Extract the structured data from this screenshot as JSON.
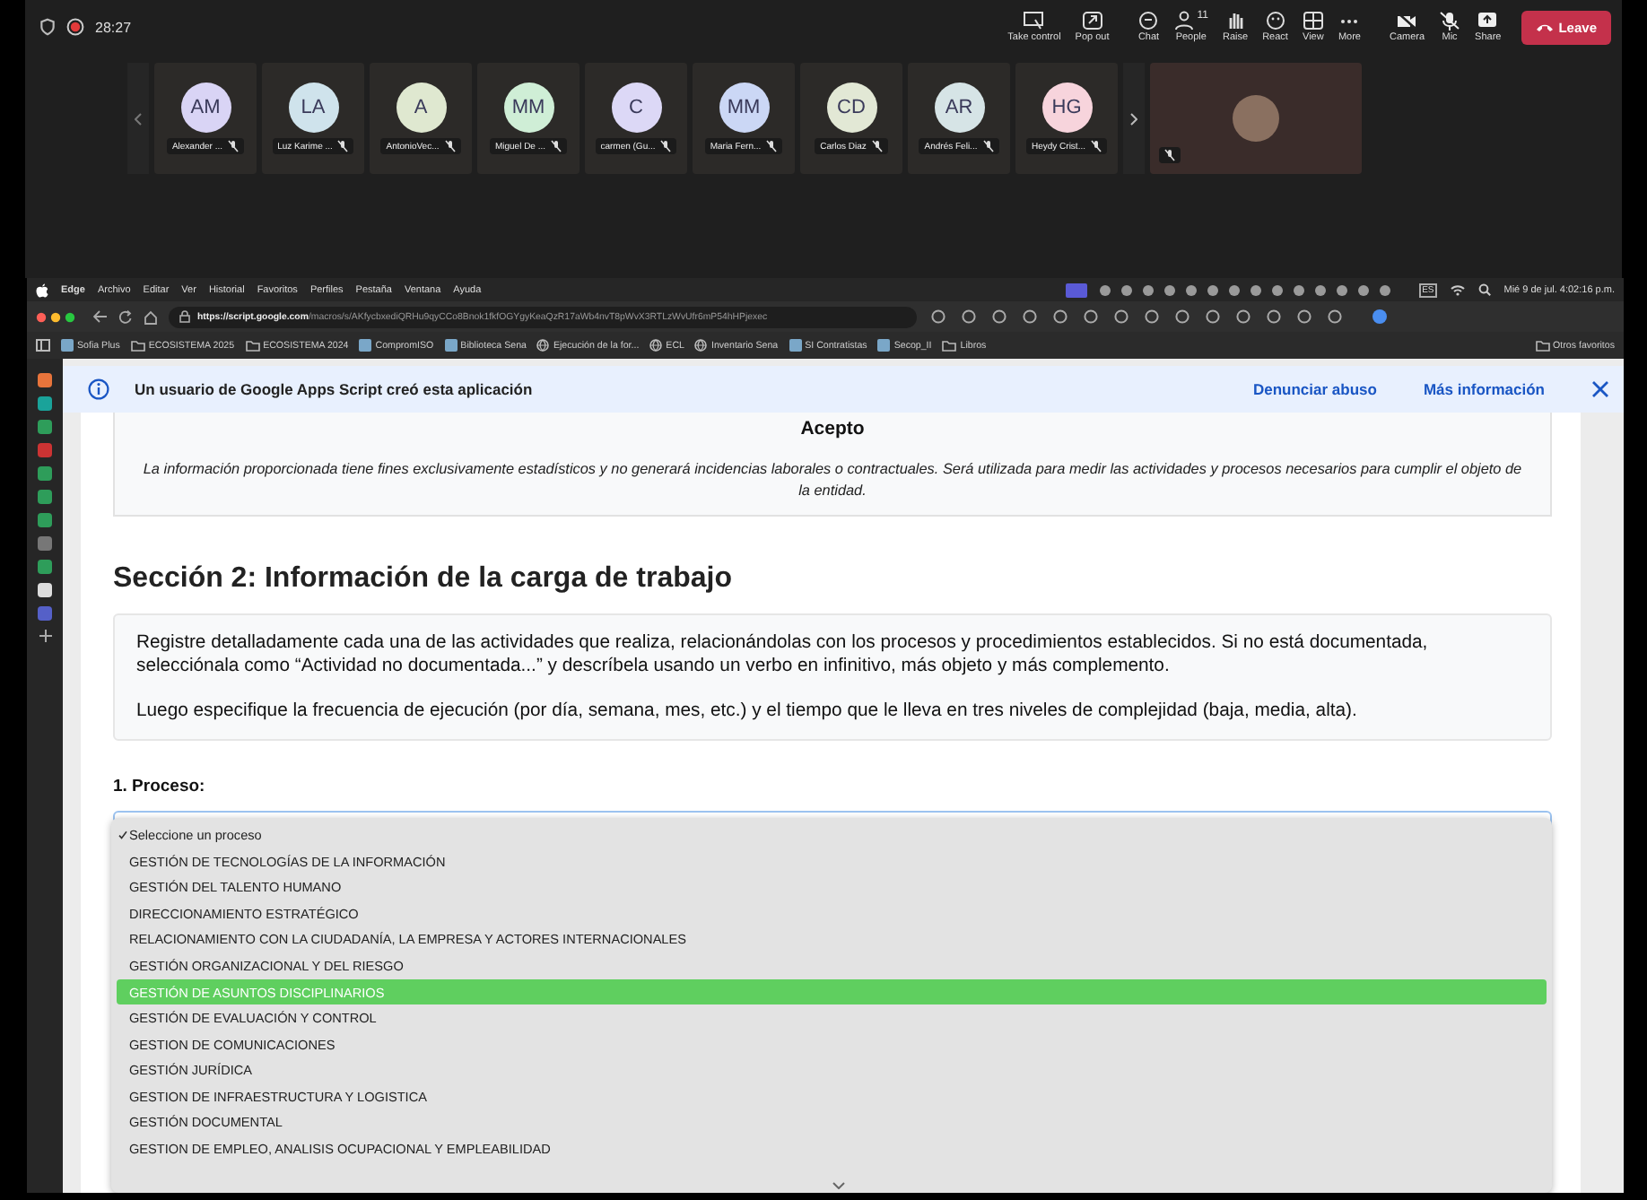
{
  "meeting": {
    "timer": "28:27",
    "recording": true,
    "toolbar": [
      {
        "label": "Take control"
      },
      {
        "label": "Pop out"
      },
      {
        "label": "Chat"
      },
      {
        "label": "People",
        "count": "11"
      },
      {
        "label": "Raise"
      },
      {
        "label": "React"
      },
      {
        "label": "View"
      },
      {
        "label": "More"
      },
      {
        "label": "Camera"
      },
      {
        "label": "Mic"
      },
      {
        "label": "Share"
      }
    ],
    "leave": "Leave",
    "participants": [
      {
        "initials": "AM",
        "name": "Alexander ...",
        "color": "#d9d4f5"
      },
      {
        "initials": "LA",
        "name": "Luz Karime ...",
        "color": "#cfe3ec"
      },
      {
        "initials": "A",
        "name": "AntonioVec...",
        "color": "#dfe8d0"
      },
      {
        "initials": "MM",
        "name": "Miguel De ...",
        "color": "#cfeed6"
      },
      {
        "initials": "C",
        "name": "carmen (Gu...",
        "color": "#dcd8f6"
      },
      {
        "initials": "MM",
        "name": "Maria Fern...",
        "color": "#cbd7f5"
      },
      {
        "initials": "CD",
        "name": "Carlos Diaz",
        "color": "#e2e8d5"
      },
      {
        "initials": "AR",
        "name": "Andrés Feli...",
        "color": "#d6e4e6"
      },
      {
        "initials": "HG",
        "name": "Heydy Crist...",
        "color": "#f7d4dc"
      }
    ]
  },
  "menu_bar": {
    "items": [
      "Edge",
      "Archivo",
      "Editar",
      "Ver",
      "Historial",
      "Favoritos",
      "Perfiles",
      "Pestaña",
      "Ventana",
      "Ayuda"
    ],
    "input_source": "ES",
    "clock": "Mié 9 de jul. 4:02:16 p.m."
  },
  "browser": {
    "url_host": "https://script.google.com",
    "url_path": "/macros/s/AKfycbxediQRHu9qyCCo8Bnok1fkfOGYgyKeaQzR17aWb4nvT8pWvX3RTLzWvUfr6mP54hHPjexec",
    "bookmarks": [
      {
        "label": "Sofia Plus",
        "kind": "site"
      },
      {
        "label": "ECOSISTEMA 2025",
        "kind": "folder"
      },
      {
        "label": "ECOSISTEMA 2024",
        "kind": "folder"
      },
      {
        "label": "CompromISO",
        "kind": "site"
      },
      {
        "label": "Biblioteca Sena",
        "kind": "site"
      },
      {
        "label": "Ejecución de la for...",
        "kind": "globe"
      },
      {
        "label": "ECL",
        "kind": "globe"
      },
      {
        "label": "Inventario Sena",
        "kind": "globe"
      },
      {
        "label": "SI Contratistas",
        "kind": "site"
      },
      {
        "label": "Secop_II",
        "kind": "site"
      },
      {
        "label": "Libros",
        "kind": "folder"
      }
    ],
    "other_bookmarks": "Otros favoritos"
  },
  "banner": {
    "text": "Un usuario de Google Apps Script creó esta aplicación",
    "links": [
      "Denunciar abuso",
      "Más información"
    ]
  },
  "consent_card": {
    "title": "Acepto",
    "text": "La información proporcionada tiene fines exclusivamente estadísticos y no generará incidencias laborales o contractuales. Será utilizada para medir las actividades y procesos necesarios para cumplir el objeto de la entidad."
  },
  "section": {
    "heading": "Sección 2: Información de la carga de trabajo",
    "instructions": [
      "Registre detalladamente cada una de las actividades que realiza, relacionándolas con los procesos y procedimientos establecidos. Si no está documentada, selecciónala como “Actividad no documentada...” y descríbela usando un verbo en infinitivo, más objeto y más complemento.",
      "Luego especifique la frecuencia de ejecución (por día, semana, mes, etc.) y el tiempo que le lleva en tres niveles de complejidad (baja, media, alta)."
    ],
    "field_label": "1. Proceso:",
    "options": [
      {
        "label": "Seleccione un proceso",
        "selected": true,
        "highlighted": false
      },
      {
        "label": "GESTIÓN DE TECNOLOGÍAS DE LA INFORMACIÓN",
        "selected": false,
        "highlighted": false
      },
      {
        "label": "GESTIÓN DEL TALENTO HUMANO",
        "selected": false,
        "highlighted": false
      },
      {
        "label": "DIRECCIONAMIENTO ESTRATÉGICO",
        "selected": false,
        "highlighted": false
      },
      {
        "label": "RELACIONAMIENTO CON LA CIUDADANÍA, LA EMPRESA Y ACTORES INTERNACIONALES",
        "selected": false,
        "highlighted": false
      },
      {
        "label": "GESTIÓN ORGANIZACIONAL Y DEL RIESGO",
        "selected": false,
        "highlighted": false
      },
      {
        "label": "GESTIÓN DE ASUNTOS DISCIPLINARIOS",
        "selected": false,
        "highlighted": true
      },
      {
        "label": "GESTIÓN DE EVALUACIÓN Y CONTROL",
        "selected": false,
        "highlighted": false
      },
      {
        "label": "GESTION DE COMUNICACIONES",
        "selected": false,
        "highlighted": false
      },
      {
        "label": "GESTIÓN JURÍDICA",
        "selected": false,
        "highlighted": false
      },
      {
        "label": "GESTION DE INFRAESTRUCTURA Y LOGISTICA",
        "selected": false,
        "highlighted": false
      },
      {
        "label": "GESTIÓN DOCUMENTAL",
        "selected": false,
        "highlighted": false
      },
      {
        "label": "GESTION DE EMPLEO, ANALISIS OCUPACIONAL Y EMPLEABILIDAD",
        "selected": false,
        "highlighted": false
      }
    ]
  }
}
